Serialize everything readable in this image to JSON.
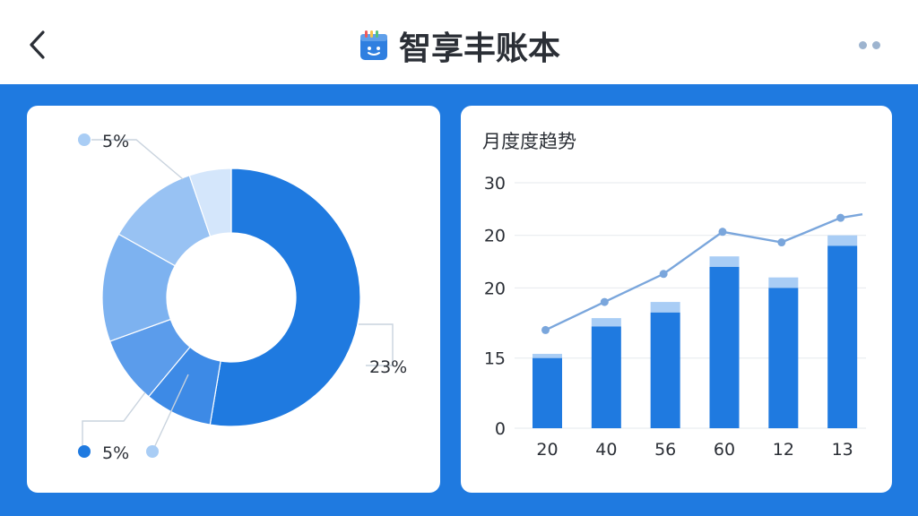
{
  "header": {
    "title": "智享丰账本",
    "back_icon": "chevron-left-icon",
    "app_icon": "notebook-icon",
    "more_icon": "more-dots-icon"
  },
  "colors": {
    "primary": "#1f7ae0",
    "bar_cap": "#a9cdf5",
    "line": "#7aa6dc",
    "grid": "#e6e9ee",
    "text": "#2b2f36"
  },
  "chart_data": [
    {
      "type": "pie",
      "title": "",
      "donut": true,
      "slices": [
        {
          "value": 50,
          "color": "#1f7ae0"
        },
        {
          "value": 8,
          "color": "#3d8ae6"
        },
        {
          "value": 8,
          "color": "#5b9ceb"
        },
        {
          "value": 13,
          "color": "#7db2f0"
        },
        {
          "value": 11,
          "color": "#98c2f3"
        },
        {
          "value": 5,
          "color": "#d4e6fb"
        }
      ],
      "labels": [
        {
          "text": "5%",
          "dot_color": "#a9cdf5"
        },
        {
          "text": "23%",
          "dot_color": null
        },
        {
          "text": "5%",
          "dot_color": "#1f7ae0"
        }
      ]
    },
    {
      "type": "bar",
      "title": "月度度趋势",
      "categories": [
        "20",
        "40",
        "56",
        "60",
        "12",
        "13"
      ],
      "series": [
        {
          "values": [
            10,
            14.5,
            16.5,
            23,
            20,
            26
          ]
        }
      ],
      "bar_caps": [
        0.6,
        1.2,
        1.5,
        1.5,
        1.5,
        1.5
      ],
      "line": [
        14,
        18,
        22,
        28,
        26.5,
        30
      ],
      "y_ticks": [
        {
          "label": "0",
          "value": 0
        },
        {
          "label": "15",
          "value": 10
        },
        {
          "label": "20",
          "value": 20
        },
        {
          "label": "20",
          "value": 27.5
        },
        {
          "label": "30",
          "value": 35
        }
      ],
      "ylim": [
        0,
        35
      ],
      "grid": true
    }
  ]
}
